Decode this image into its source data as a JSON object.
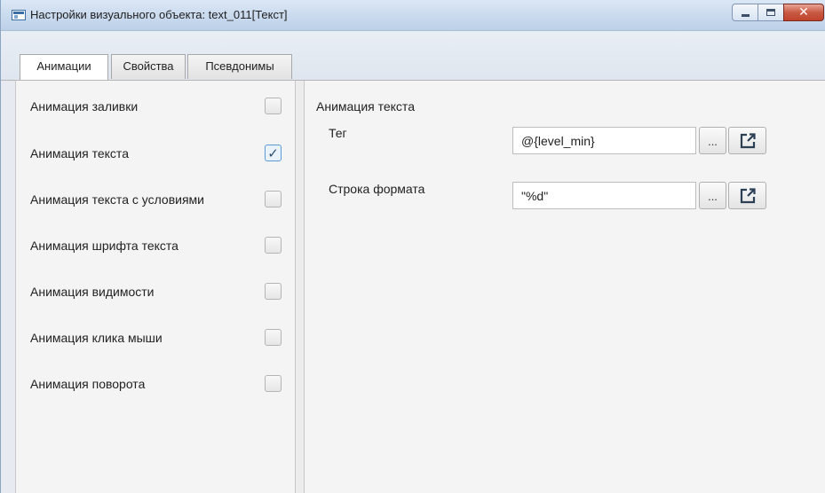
{
  "window": {
    "title": "Настройки визуального объекта: text_011[Текст]",
    "controls": {
      "minimize": "minimize-icon",
      "maximize": "maximize-icon",
      "close": "close-icon"
    }
  },
  "tabs": [
    {
      "label": "Анимации",
      "active": true
    },
    {
      "label": "Свойства",
      "active": false
    },
    {
      "label": "Псевдонимы",
      "active": false
    }
  ],
  "animations": [
    {
      "label": "Анимация заливки",
      "checked": false
    },
    {
      "label": "Анимация текста",
      "checked": true
    },
    {
      "label": "Анимация текста с условиями",
      "checked": false
    },
    {
      "label": "Анимация шрифта текста",
      "checked": false
    },
    {
      "label": "Анимация видимости",
      "checked": false
    },
    {
      "label": "Анимация клика мыши",
      "checked": false
    },
    {
      "label": "Анимация поворота",
      "checked": false
    }
  ],
  "detail": {
    "section_title": "Анимация текста",
    "fields": [
      {
        "label": "Тег",
        "value": "@{level_min}",
        "browse_label": "...",
        "open_icon": "external-link-icon"
      },
      {
        "label": "Строка формата",
        "value": "\"%d\"",
        "browse_label": "...",
        "open_icon": "external-link-icon"
      }
    ]
  },
  "colors": {
    "accent": "#5b9bd5",
    "titlebar": "#c9daee",
    "close_button": "#c95a44"
  }
}
